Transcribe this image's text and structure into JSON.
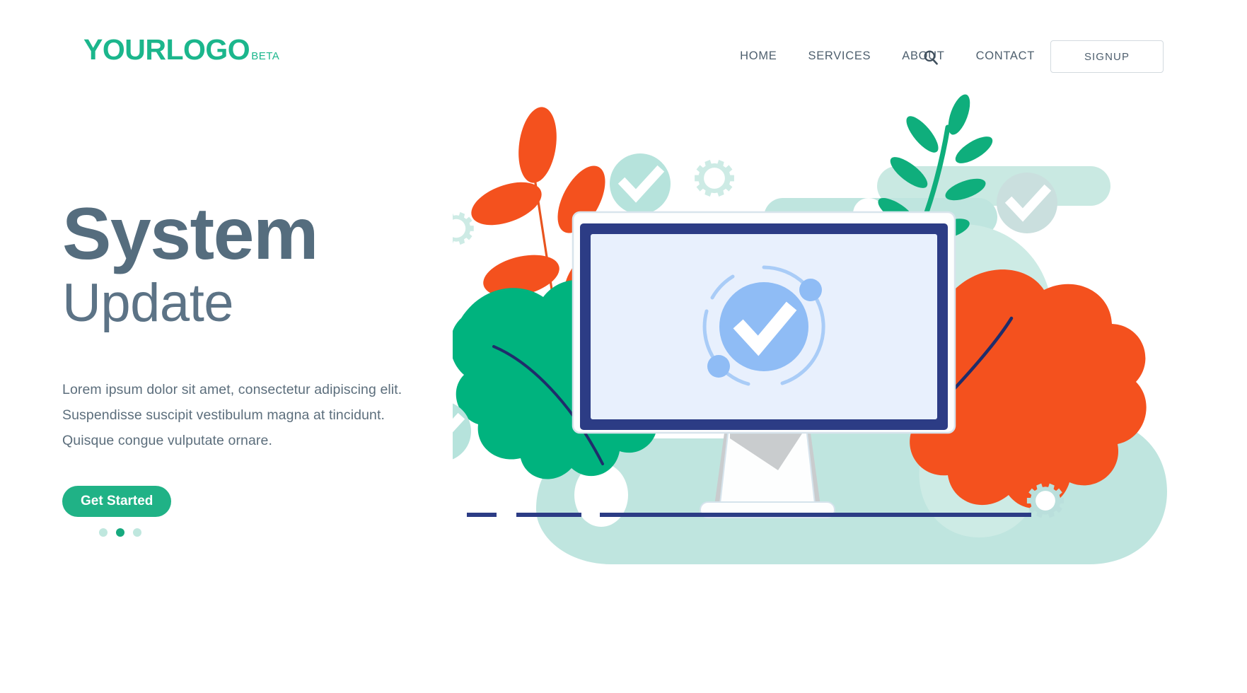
{
  "header": {
    "logo": {
      "main": "YOURLOGO",
      "beta": "BETA",
      "color": "#1BB68C"
    },
    "nav": [
      {
        "label": "HOME",
        "name": "nav-home"
      },
      {
        "label": "SERVICES",
        "name": "nav-services"
      },
      {
        "label": "ABOUT",
        "name": "nav-about"
      },
      {
        "label": "CONTACT",
        "name": "nav-contact"
      }
    ],
    "search_icon": "search-icon",
    "signup_label": "SIGNUP"
  },
  "hero": {
    "title_line1": "System",
    "title_line2": "Update",
    "paragraph": [
      "Lorem ipsum dolor sit amet, consectetur adipiscing elit.",
      "Suspendisse suscipit vestibulum magna at tincidunt.",
      "Quisque congue vulputate ornare."
    ],
    "cta_label": "Get Started",
    "carousel": {
      "count": 3,
      "active_index": 1
    }
  },
  "illustration": {
    "name": "system-update-illustration",
    "screen_icon": "check-circle-icon",
    "decorations": [
      "orange-leaf-branch",
      "green-oak-leaf",
      "green-fern-frond",
      "orange-oak-leaf",
      "mint-check-circle",
      "gear-icon",
      "mint-blob",
      "desktop-monitor"
    ]
  },
  "colors": {
    "brand_teal": "#20B286",
    "heading_slate": "#556D7E",
    "body_slate": "#5C6E7C",
    "navy": "#2C3C85",
    "orange": "#F4511E",
    "green": "#00B37E",
    "mint": "#B6E3DC",
    "mint_light": "#CDEBE5",
    "screen_blue": "#E8F0FD",
    "accent_blue": "#8FBCF5"
  }
}
